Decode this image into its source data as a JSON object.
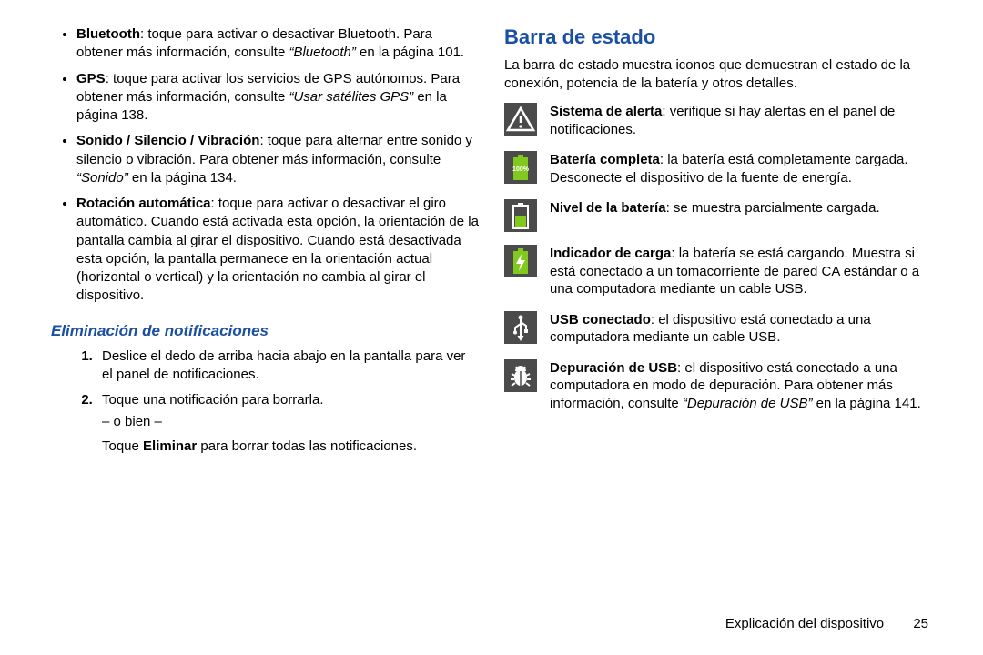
{
  "left": {
    "bullets": [
      {
        "bold": "Bluetooth",
        "rest1": ": toque para activar o desactivar Bluetooth. Para obtener más información, consulte ",
        "ref": "“Bluetooth”",
        "rest2": " en la página 101."
      },
      {
        "bold": "GPS",
        "rest1": ": toque para activar los servicios de GPS autónomos. Para obtener más información, consulte ",
        "ref": "“Usar satélites GPS”",
        "rest2": " en la página 138."
      },
      {
        "bold": "Sonido / Silencio / Vibración",
        "rest1": ": toque para alternar entre sonido y silencio o vibración. Para obtener más información, consulte ",
        "ref": "“Sonido”",
        "rest2": " en la página 134."
      },
      {
        "bold": "Rotación automática",
        "rest1": ": toque para activar o desactivar el giro automático. Cuando está activada esta opción, la orientación de la pantalla cambia al girar el dispositivo. Cuando está desactivada esta opción, la pantalla permanece en la orientación actual (horizontal o vertical) y la orientación no cambia al girar el dispositivo.",
        "ref": "",
        "rest2": ""
      }
    ],
    "subheading": "Eliminación de notificaciones",
    "step1": "Deslice el dedo de arriba hacia abajo en la pantalla para ver el panel de notificaciones.",
    "step2a": "Toque una notificación para borrarla.",
    "obien": "– o bien –",
    "step2b_pre": "Toque ",
    "step2b_bold": "Eliminar",
    "step2b_post": " para borrar todas las notificaciones."
  },
  "right": {
    "heading": "Barra de estado",
    "lead": "La barra de estado muestra iconos que demuestran el estado de la conexión, potencia de la batería y otros detalles.",
    "items": [
      {
        "bold": "Sistema de alerta",
        "rest1": ": verifique si hay alertas en el panel de notificaciones.",
        "ref": "",
        "rest2": ""
      },
      {
        "bold": "Batería completa",
        "rest1": ": la batería está completamente cargada. Desconecte el dispositivo de la fuente de energía.",
        "ref": "",
        "rest2": ""
      },
      {
        "bold": "Nivel de la batería",
        "rest1": ": se muestra parcialmente cargada.",
        "ref": "",
        "rest2": ""
      },
      {
        "bold": "Indicador de carga",
        "rest1": ": la batería se está cargando. Muestra si está conectado a un tomacorriente de pared CA estándar o a una computadora mediante un cable USB.",
        "ref": "",
        "rest2": ""
      },
      {
        "bold": "USB conectado",
        "rest1": ": el dispositivo está conectado a una computadora mediante un cable USB.",
        "ref": "",
        "rest2": ""
      },
      {
        "bold": "Depuración de USB",
        "rest1": ": el dispositivo está conectado a una computadora en modo de depuración. Para obtener más información, consulte ",
        "ref": "“Depuración de USB”",
        "rest2": " en la página 141."
      }
    ]
  },
  "footer": {
    "label": "Explicación del dispositivo",
    "page": "25"
  }
}
